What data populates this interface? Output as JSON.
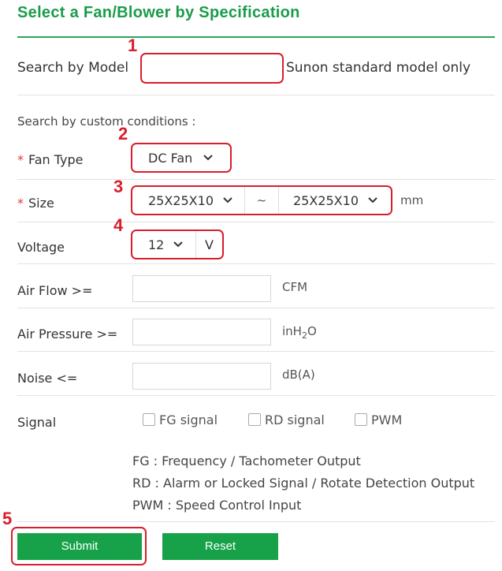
{
  "header": {
    "title": "Select a Fan/Blower by Specification"
  },
  "search_model": {
    "label": "Search by Model",
    "value": "",
    "hint": "Sunon standard model only"
  },
  "custom": {
    "heading": "Search by custom conditions :"
  },
  "fan_type": {
    "required_mark": "*",
    "label": "Fan Type",
    "selected": "DC Fan"
  },
  "size": {
    "required_mark": "*",
    "label": "Size",
    "from": "25X25X10",
    "sep": "~",
    "to": "25X25X10",
    "unit": "mm"
  },
  "voltage": {
    "label": "Voltage",
    "selected": "12",
    "unit": "V"
  },
  "airflow": {
    "label": "Air Flow >=",
    "value": "",
    "unit": "CFM"
  },
  "pressure": {
    "label": "Air Pressure >=",
    "value": "",
    "unit_prefix": "inH",
    "unit_sub": "2",
    "unit_suffix": "O"
  },
  "noise": {
    "label": "Noise <=",
    "value": "",
    "unit": "dB(A)"
  },
  "signal": {
    "label": "Signal",
    "options": [
      "FG signal",
      "RD signal",
      "PWM"
    ],
    "notes": [
      "FG : Frequency / Tachometer Output",
      "RD : Alarm or Locked Signal / Rotate Detection Output",
      "PWM : Speed Control Input"
    ]
  },
  "buttons": {
    "submit": "Submit",
    "reset": "Reset"
  },
  "annotations": [
    "1",
    "2",
    "3",
    "4",
    "5"
  ],
  "colors": {
    "accent": "#17a24a",
    "annotation": "#d81e2b"
  }
}
